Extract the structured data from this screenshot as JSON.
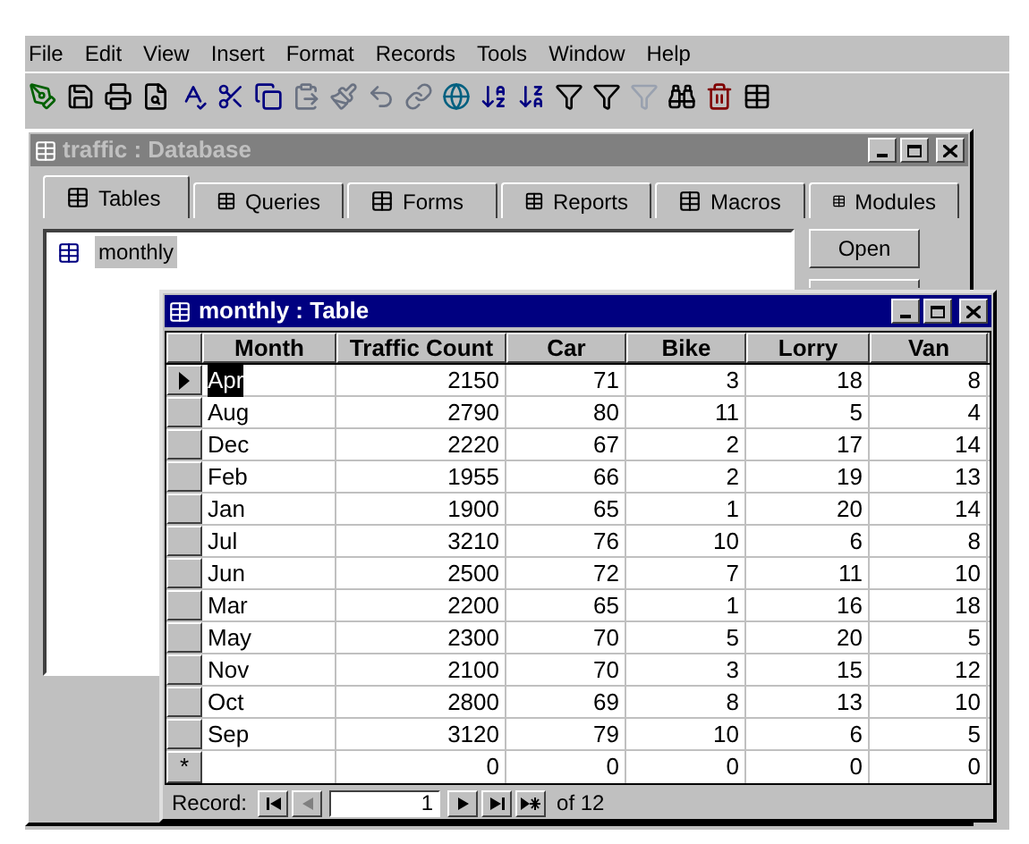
{
  "menu": [
    "File",
    "Edit",
    "View",
    "Insert",
    "Format",
    "Records",
    "Tools",
    "Window",
    "Help"
  ],
  "database_window": {
    "title": "traffic : Database",
    "tabs": [
      {
        "label": "Tables",
        "selected": true
      },
      {
        "label": "Queries",
        "selected": false
      },
      {
        "label": "Forms",
        "selected": false
      },
      {
        "label": "Reports",
        "selected": false
      },
      {
        "label": "Macros",
        "selected": false
      },
      {
        "label": "Modules",
        "selected": false
      }
    ],
    "items": [
      {
        "label": "monthly",
        "selected": true
      }
    ],
    "buttons": [
      "Open"
    ]
  },
  "table_window": {
    "title": "monthly : Table",
    "columns": [
      "Month",
      "Traffic Count",
      "Car",
      "Bike",
      "Lorry",
      "Van"
    ],
    "rows": [
      {
        "current": true,
        "cells": [
          "Apr",
          "2150",
          "71",
          "3",
          "18",
          "8"
        ]
      },
      {
        "current": false,
        "cells": [
          "Aug",
          "2790",
          "80",
          "11",
          "5",
          "4"
        ]
      },
      {
        "current": false,
        "cells": [
          "Dec",
          "2220",
          "67",
          "2",
          "17",
          "14"
        ]
      },
      {
        "current": false,
        "cells": [
          "Feb",
          "1955",
          "66",
          "2",
          "19",
          "13"
        ]
      },
      {
        "current": false,
        "cells": [
          "Jan",
          "1900",
          "65",
          "1",
          "20",
          "14"
        ]
      },
      {
        "current": false,
        "cells": [
          "Jul",
          "3210",
          "76",
          "10",
          "6",
          "8"
        ]
      },
      {
        "current": false,
        "cells": [
          "Jun",
          "2500",
          "72",
          "7",
          "11",
          "10"
        ]
      },
      {
        "current": false,
        "cells": [
          "Mar",
          "2200",
          "65",
          "1",
          "16",
          "18"
        ]
      },
      {
        "current": false,
        "cells": [
          "May",
          "2300",
          "70",
          "5",
          "20",
          "5"
        ]
      },
      {
        "current": false,
        "cells": [
          "Nov",
          "2100",
          "70",
          "3",
          "15",
          "12"
        ]
      },
      {
        "current": false,
        "cells": [
          "Oct",
          "2800",
          "69",
          "8",
          "13",
          "10"
        ]
      },
      {
        "current": false,
        "cells": [
          "Sep",
          "3120",
          "79",
          "10",
          "6",
          "5"
        ]
      }
    ],
    "new_row": {
      "marker": "*",
      "cells": [
        "",
        "0",
        "0",
        "0",
        "0",
        "0"
      ]
    },
    "record_bar": {
      "label": "Record:",
      "value": "1",
      "total": "of 12"
    }
  }
}
